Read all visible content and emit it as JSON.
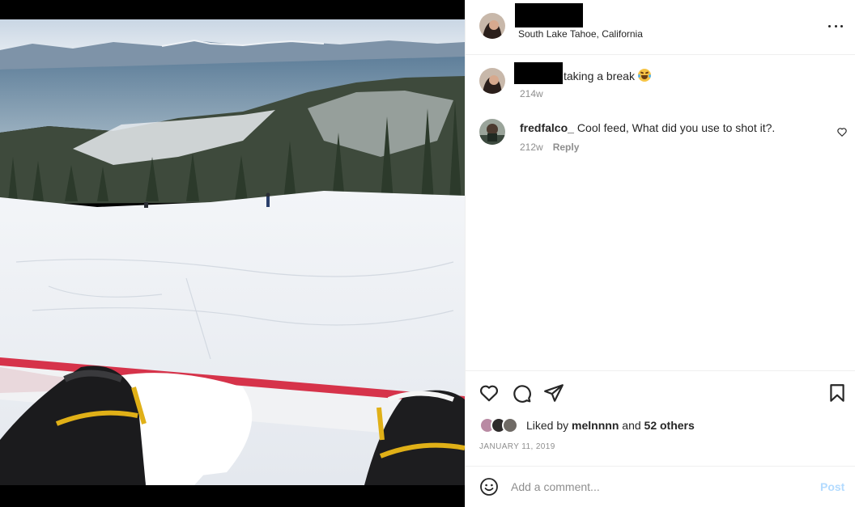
{
  "post": {
    "username_redacted": true,
    "location": "South Lake Tahoe, California",
    "more_options_icon": "more-horizontal-icon"
  },
  "caption": {
    "username_redacted": true,
    "text": "taking a break",
    "emoji": "face-with-tears-of-joy",
    "age": "214w"
  },
  "comments": [
    {
      "username": "fredfalco_",
      "text": "Cool feed, What did you use to shot it?.",
      "age": "212w",
      "reply_label": "Reply"
    }
  ],
  "actions": {
    "like_icon": "heart-icon",
    "comment_icon": "comment-icon",
    "share_icon": "send-icon",
    "save_icon": "bookmark-icon"
  },
  "likes": {
    "prefix": "Liked by",
    "first_user": "melnnnn",
    "joiner": "and",
    "others": "52 others"
  },
  "date": "JANUARY 11, 2019",
  "add_comment": {
    "placeholder": "Add a comment...",
    "post_label": "Post"
  },
  "colors": {
    "text": "#262626",
    "secondary": "#8e8e8e",
    "post_disabled": "#b3dbff",
    "divider": "#efefef"
  }
}
